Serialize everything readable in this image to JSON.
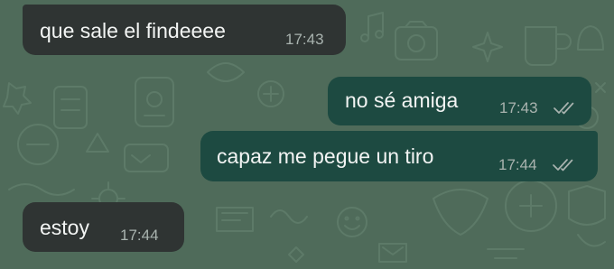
{
  "chat": {
    "wallpaper_color": "#4f6b5a",
    "incoming_color": "#2f3433",
    "outgoing_color": "#1d4a41",
    "messages": [
      {
        "direction": "incoming",
        "text": "que sale el findeeee",
        "time": "17:43"
      },
      {
        "direction": "outgoing",
        "text": "no sé amiga",
        "time": "17:43",
        "status_icon": "double-check-read-icon"
      },
      {
        "direction": "outgoing",
        "text": "capaz me pegue un tiro",
        "time": "17:44",
        "status_icon": "double-check-read-icon"
      },
      {
        "direction": "incoming",
        "text": "estoy",
        "time": "17:44"
      }
    ]
  }
}
